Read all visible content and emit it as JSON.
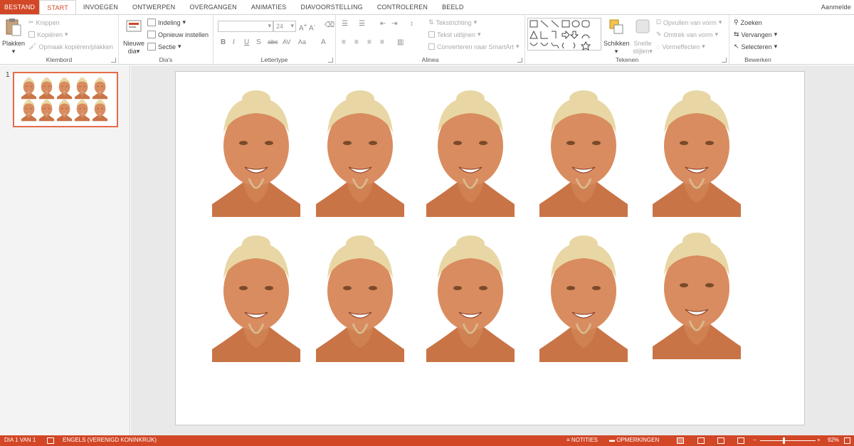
{
  "tabs": [
    {
      "label": "BESTAND",
      "kind": "file"
    },
    {
      "label": "START",
      "kind": "active"
    },
    {
      "label": "INVOEGEN",
      "kind": ""
    },
    {
      "label": "ONTWERPEN",
      "kind": ""
    },
    {
      "label": "OVERGANGEN",
      "kind": ""
    },
    {
      "label": "ANIMATIES",
      "kind": ""
    },
    {
      "label": "DIAVOORSTELLING",
      "kind": ""
    },
    {
      "label": "CONTROLEREN",
      "kind": ""
    },
    {
      "label": "BEELD",
      "kind": ""
    }
  ],
  "signin": "Aanmelde",
  "ribbon": {
    "klembord": {
      "label": "Klembord",
      "plakken": "Plakken",
      "knippen": "Knippen",
      "kopieren": "Kopiëren",
      "opmaak": "Opmaak kopiëren/plakken"
    },
    "dias": {
      "label": "Dia's",
      "nieuwe": "Nieuwe",
      "dia": "dia",
      "indeling": "Indeling",
      "opnieuw": "Opnieuw instellen",
      "sectie": "Sectie"
    },
    "lettertype": {
      "label": "Lettertype",
      "size": "24",
      "bold": "B",
      "italic": "I",
      "underline": "U",
      "strike": "S",
      "abc": "abc",
      "av": "AV",
      "aa": "Aa",
      "fontcolor": "A"
    },
    "alinea": {
      "label": "Alinea",
      "tekstrichting": "Tekstrichting",
      "uitlijnen": "Tekst uitlijnen",
      "smartart": "Converteren naar SmartArt"
    },
    "tekenen": {
      "label": "Tekenen",
      "schikken": "Schikken",
      "snelle": "Snelle",
      "stijlen": "stijlen",
      "opvullen": "Opvullen van vorm",
      "omtrek": "Omtrek van vorm",
      "vormeffecten": "Vormeffecten"
    },
    "bewerken": {
      "label": "Bewerken",
      "zoeken": "Zoeken",
      "vervangen": "Vervangen",
      "selecteren": "Selecteren"
    }
  },
  "slides_pane": {
    "number": "1"
  },
  "photo_grid": {
    "rows": 2,
    "cols": 5,
    "count": 10
  },
  "status": {
    "slide": "DIA 1 VAN 1",
    "language": "ENGELS (VERENIGD KONINKRIJK)",
    "notes": "NOTITIES",
    "comments": "OPMERKINGEN",
    "zoom_minus": "−",
    "zoom_plus": "+",
    "zoom": "92%"
  },
  "colors": {
    "accent": "#d24726",
    "skin": "#d98c5f",
    "hair": "#e8d7a4"
  }
}
